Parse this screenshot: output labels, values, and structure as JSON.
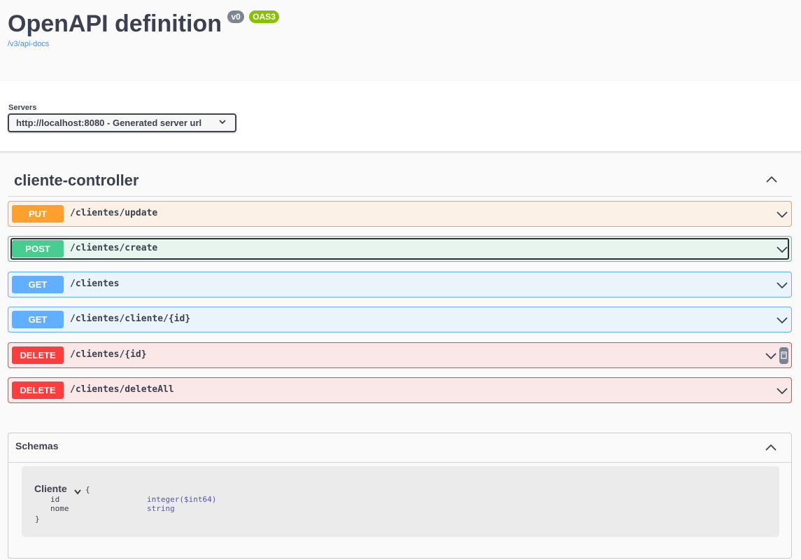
{
  "info": {
    "title": "OpenAPI definition",
    "version_badge": "v0",
    "oas_badge": "OAS3",
    "docs_link": "/v3/api-docs"
  },
  "servers": {
    "label": "Servers",
    "selected": "http://localhost:8080 - Generated server url"
  },
  "tag": {
    "name": "cliente-controller"
  },
  "operations": [
    {
      "method": "PUT",
      "path": "/clientes/update"
    },
    {
      "method": "POST",
      "path": "/clientes/create"
    },
    {
      "method": "GET",
      "path": "/clientes"
    },
    {
      "method": "GET",
      "path": "/clientes/cliente/{id}"
    },
    {
      "method": "DELETE",
      "path": "/clientes/{id}"
    },
    {
      "method": "DELETE",
      "path": "/clientes/deleteAll"
    }
  ],
  "schemas": {
    "title": "Schemas",
    "model": {
      "name": "Cliente",
      "open_brace": "{",
      "close_brace": "}",
      "properties": [
        {
          "name": "id",
          "type": "integer($int64)"
        },
        {
          "name": "nome",
          "type": "string"
        }
      ]
    }
  },
  "colors": {
    "put": "#fca130",
    "post": "#49cc90",
    "get": "#61affe",
    "delete": "#f93e3e",
    "link": "#4990e2"
  }
}
